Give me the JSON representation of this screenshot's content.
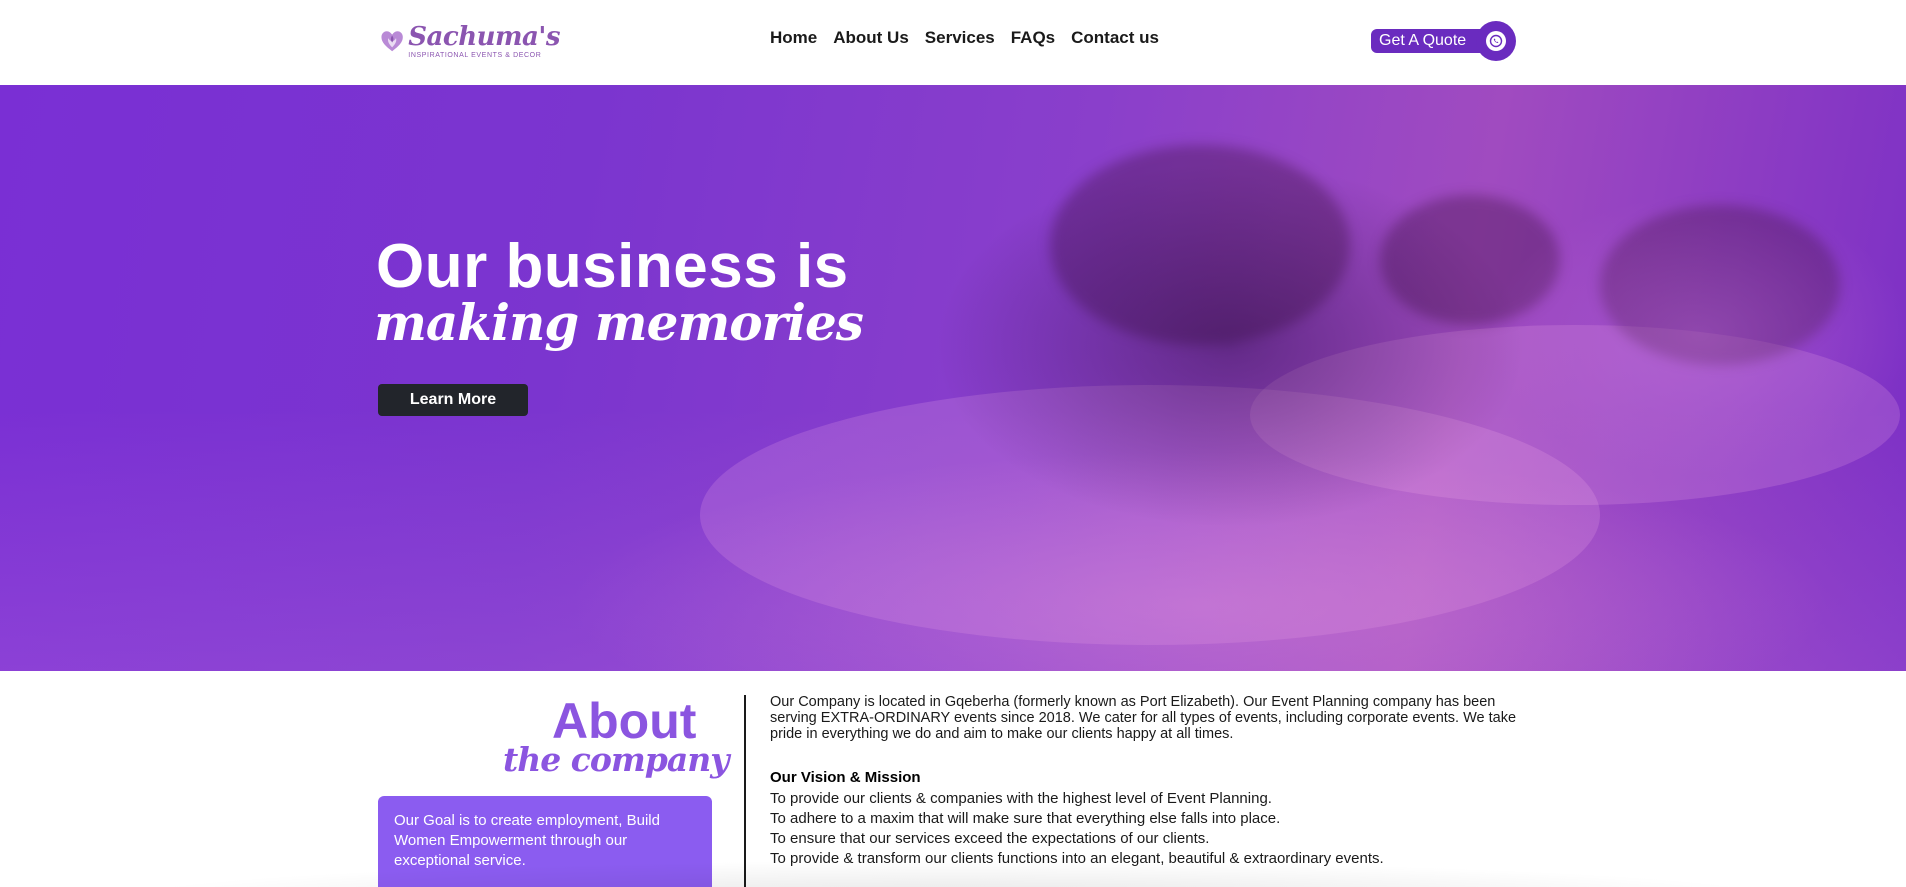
{
  "brand": {
    "name": "Sachuma's",
    "tagline": "INSPIRATIONAL EVENTS & DECOR",
    "logo_icon": "heart-flower-icon",
    "accent_color": "#6a2bbf"
  },
  "nav": {
    "items": [
      {
        "label": "Home"
      },
      {
        "label": "About Us"
      },
      {
        "label": "Services"
      },
      {
        "label": "FAQs"
      },
      {
        "label": "Contact us"
      }
    ]
  },
  "quote_button": {
    "label": "Get A Quote",
    "icon": "whatsapp-icon"
  },
  "hero": {
    "title_line1": "Our business is",
    "title_line2": "making memories",
    "cta_label": "Learn More"
  },
  "about": {
    "title": "About",
    "subtitle": "the company",
    "goal": "Our Goal is to create employment, Build Women Empowerment through our exceptional service.",
    "description": "Our Company is located in Gqeberha (formerly known as Port Elizabeth). Our Event Planning company has been serving EXTRA-ORDINARY events since 2018. We cater for all types of events, including corporate events. We take pride in everything we do and aim to make our clients happy at all times.",
    "vision_title": "Our Vision & Mission",
    "vision_items": [
      "To provide our clients & companies with the highest level of Event Planning.",
      "To adhere to a maxim that will make sure that everything else falls into place.",
      "To ensure that our services exceed the expectations of our clients.",
      "To provide & transform our clients functions into an elegant, beautiful & extraordinary events."
    ]
  }
}
